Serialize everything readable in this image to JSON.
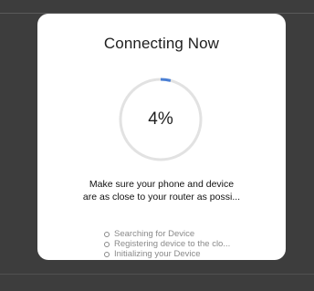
{
  "dialog": {
    "title": "Connecting Now",
    "progress": {
      "percent": 4,
      "label": "4%",
      "track_color": "#e2e2e2",
      "fill_color": "#4a7fd4"
    },
    "message_lines": [
      "Make sure your phone and device",
      "are as close to your router as possi..."
    ],
    "steps": [
      {
        "label": "Searching for Device"
      },
      {
        "label": "Registering device to the clo..."
      },
      {
        "label": "Initializing your Device"
      }
    ]
  }
}
